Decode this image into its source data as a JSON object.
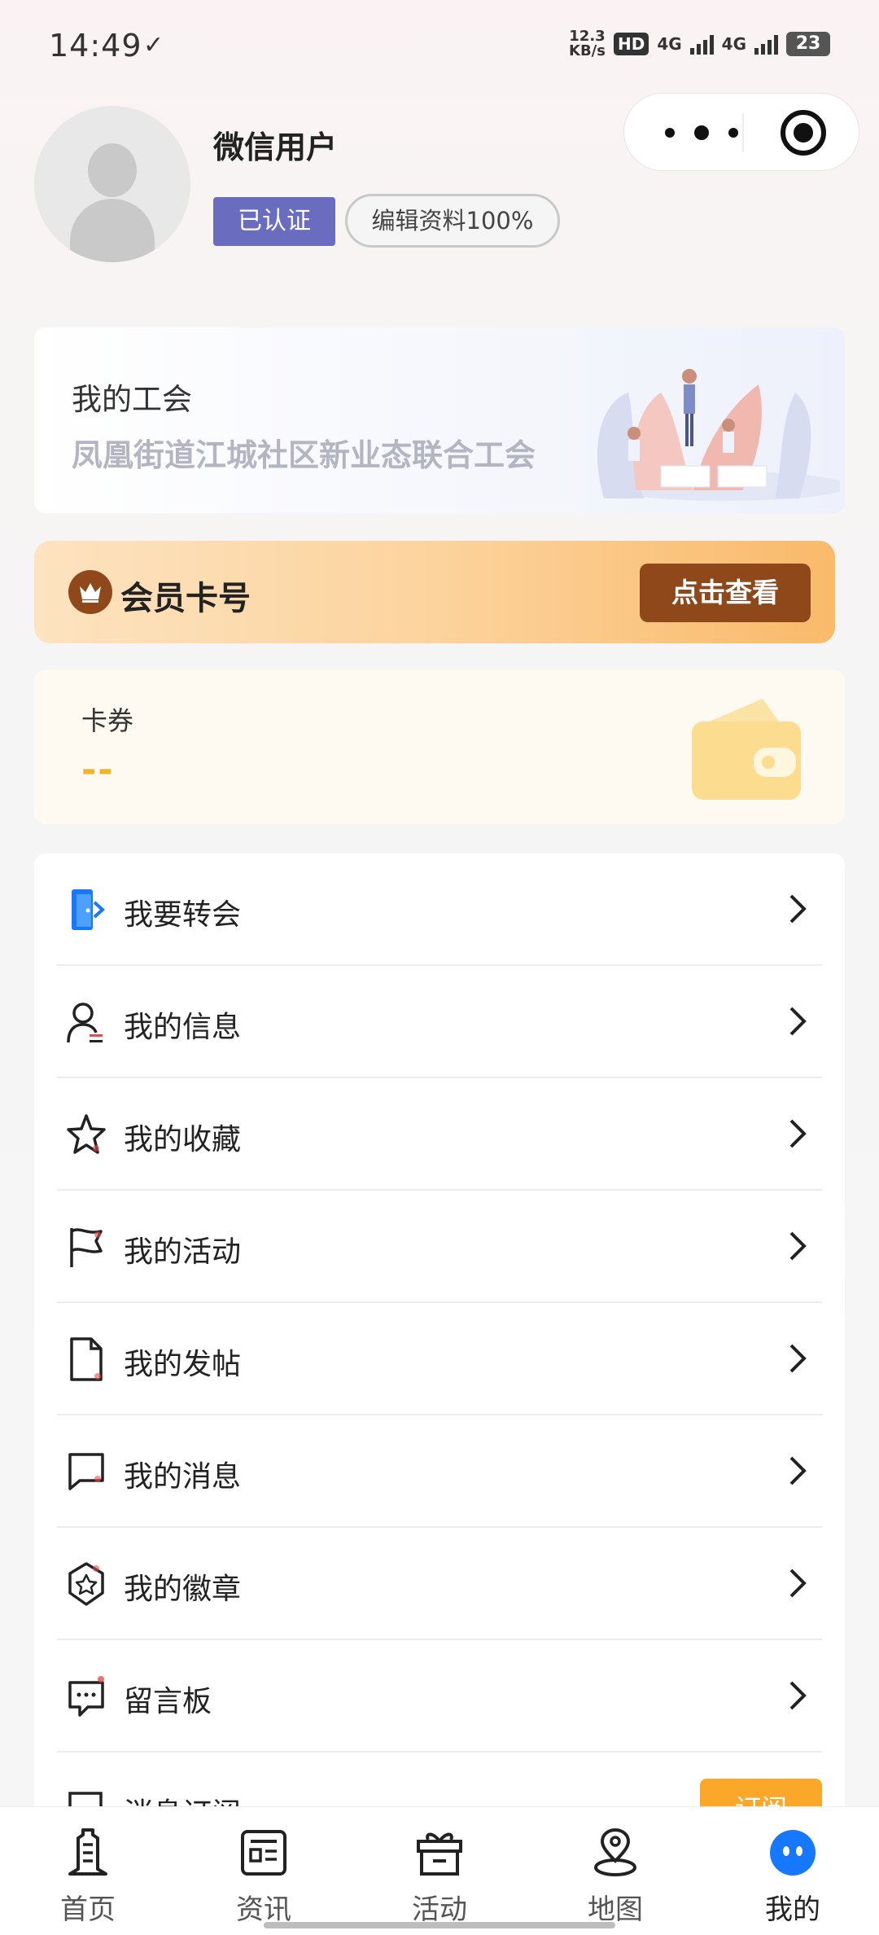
{
  "status_bar": {
    "time": "14:49",
    "time_icon": "check-icon",
    "net_speed_value": "12.3",
    "net_speed_unit": "KB/s",
    "hd_label": "HD",
    "sim1_label": "4G",
    "sim2_label": "4G",
    "battery": "23"
  },
  "capsule": {
    "more_icon": "more-dots-icon",
    "close_icon": "target-icon"
  },
  "profile": {
    "username": "微信用户",
    "verified_label": "已认证",
    "edit_label": "编辑资料100%"
  },
  "union": {
    "title": "我的工会",
    "name": "凤凰街道江城社区新业态联合工会"
  },
  "member_card": {
    "label": "会员卡号",
    "button": "点击查看"
  },
  "coupon": {
    "title": "卡券",
    "value": "--"
  },
  "menu": {
    "items": [
      {
        "label": "我要转会",
        "icon": "transfer-icon"
      },
      {
        "label": "我的信息",
        "icon": "user-info-icon"
      },
      {
        "label": "我的收藏",
        "icon": "star-icon"
      },
      {
        "label": "我的活动",
        "icon": "flag-icon"
      },
      {
        "label": "我的发帖",
        "icon": "document-icon"
      },
      {
        "label": "我的消息",
        "icon": "message-icon"
      },
      {
        "label": "我的徽章",
        "icon": "badge-icon"
      },
      {
        "label": "留言板",
        "icon": "comment-icon"
      },
      {
        "label": "消息订阅",
        "icon": "subscribe-icon",
        "button": "订阅"
      }
    ]
  },
  "tabbar": {
    "tabs": [
      {
        "label": "首页",
        "icon": "home-tower-icon"
      },
      {
        "label": "资讯",
        "icon": "news-icon"
      },
      {
        "label": "活动",
        "icon": "gift-icon"
      },
      {
        "label": "地图",
        "icon": "map-pin-icon"
      },
      {
        "label": "我的",
        "icon": "profile-face-icon",
        "active": true
      }
    ]
  },
  "colors": {
    "accent_blue": "#1677ff",
    "verified_bg": "#6a6cc0",
    "member_button": "#8f4819",
    "coupon_value": "#f5b324",
    "subscribe_button": "#fba72a"
  }
}
